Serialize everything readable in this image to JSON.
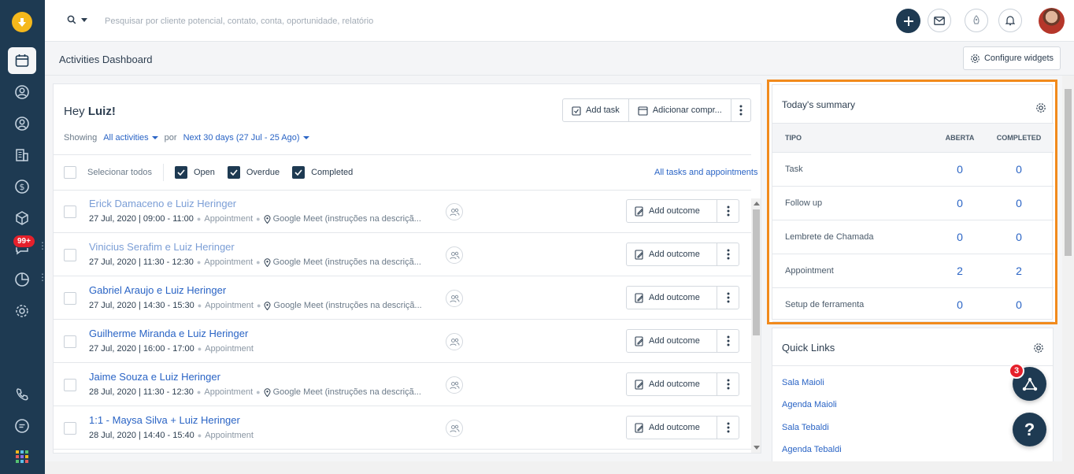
{
  "search": {
    "placeholder": "Pesquisar por cliente potencial, contato, conta, oportunidade, relatório"
  },
  "sidebar": {
    "badge": "99+"
  },
  "header": {
    "title": "Activities Dashboard",
    "configure_label": "Configure widgets"
  },
  "activities": {
    "greeting_prefix": "Hey",
    "greeting_name": "Luiz!",
    "add_task_label": "Add task",
    "add_appointment_label": "Adicionar compr...",
    "showing_label": "Showing",
    "filter_activities": "All activities",
    "por_label": "por",
    "filter_period": "Next 30 days (27 Jul - 25 Ago)",
    "select_all_label": "Selecionar todos",
    "status_open": "Open",
    "status_overdue": "Overdue",
    "status_completed": "Completed",
    "all_tasks_link": "All tasks and appointments",
    "outcome_label": "Add outcome",
    "items": [
      {
        "title": "Erick Damaceno e Luiz Heringer",
        "muted": true,
        "datetime": "27 Jul, 2020 | 09:00 - 11:00",
        "type": "Appointment",
        "location": "Google Meet (instruções na descriçã..."
      },
      {
        "title": "Vinicius Serafim e Luiz Heringer",
        "muted": true,
        "datetime": "27 Jul, 2020 | 11:30 - 12:30",
        "type": "Appointment",
        "location": "Google Meet (instruções na descriçã..."
      },
      {
        "title": "Gabriel Araujo e Luiz Heringer",
        "muted": false,
        "datetime": "27 Jul, 2020 | 14:30 - 15:30",
        "type": "Appointment",
        "location": "Google Meet (instruções na descriçã..."
      },
      {
        "title": "Guilherme Miranda e Luiz Heringer",
        "muted": false,
        "datetime": "27 Jul, 2020 | 16:00 - 17:00",
        "type": "Appointment",
        "location": ""
      },
      {
        "title": "Jaime Souza e Luiz Heringer",
        "muted": false,
        "datetime": "28 Jul, 2020 | 11:30 - 12:30",
        "type": "Appointment",
        "location": "Google Meet (instruções na descriçã..."
      },
      {
        "title": "1:1 - Maysa Silva + Luiz Heringer",
        "muted": false,
        "datetime": "28 Jul, 2020 | 14:40 - 15:40",
        "type": "Appointment",
        "location": ""
      }
    ]
  },
  "summary": {
    "title": "Today's summary",
    "col_tipo": "TIPO",
    "col_aberta": "ABERTA",
    "col_completed": "COMPLETED",
    "rows": [
      {
        "tipo": "Task",
        "aberta": "0",
        "completed": "0"
      },
      {
        "tipo": "Follow up",
        "aberta": "0",
        "completed": "0"
      },
      {
        "tipo": "Lembrete de Chamada",
        "aberta": "0",
        "completed": "0"
      },
      {
        "tipo": "Appointment",
        "aberta": "2",
        "completed": "2"
      },
      {
        "tipo": "Setup de ferramenta",
        "aberta": "0",
        "completed": "0"
      }
    ]
  },
  "quick_links": {
    "title": "Quick Links",
    "items": [
      "Sala Maioli",
      "Agenda Maioli",
      "Sala Tebaldi",
      "Agenda Tebaldi"
    ]
  },
  "fab": {
    "badge": "3",
    "help": "?"
  },
  "colors": {
    "accent": "#1e3a52",
    "link": "#2a64c5",
    "highlight": "#f18a1c",
    "brand": "#f5b81c",
    "badge": "#e5202b"
  }
}
